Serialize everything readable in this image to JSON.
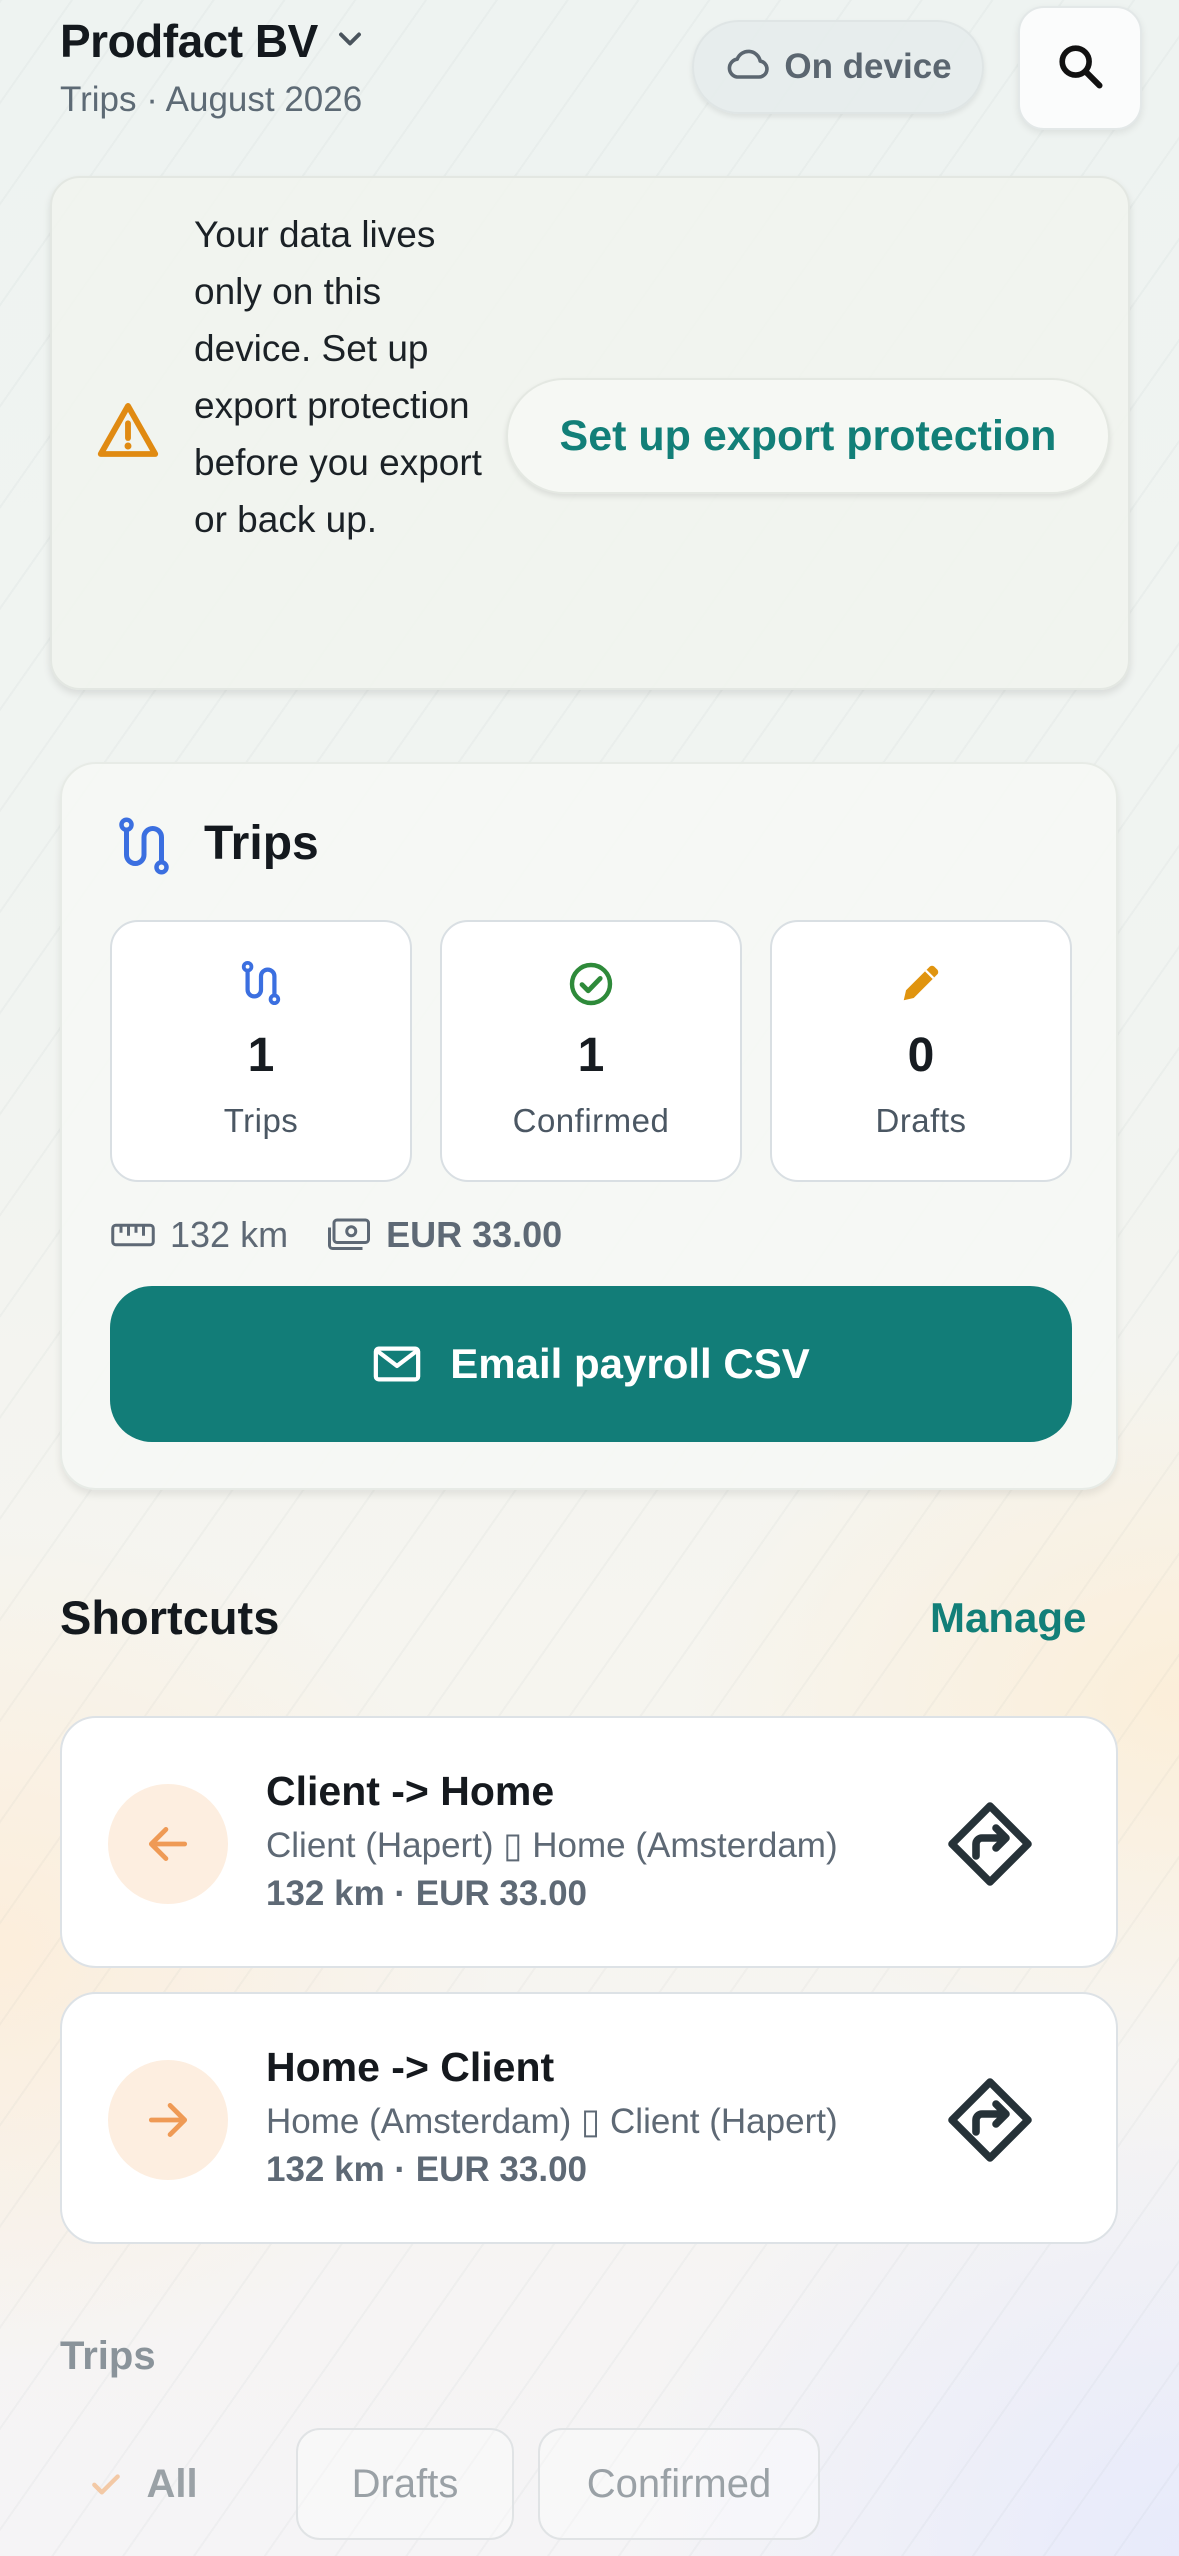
{
  "header": {
    "company": "Prodfact BV",
    "subtitle": "Trips · August 2026",
    "storage_badge": "On device",
    "icons": {
      "dropdown": "chevron-down-icon",
      "storage": "cloud-icon",
      "search": "search-icon"
    }
  },
  "banner": {
    "text": "Your data lives only on this device. Set up export protection before you export or back up.",
    "button": "Set up export protection",
    "icon": "warning-icon",
    "colors": {
      "warning": "#e08a12",
      "accent": "#127f78"
    }
  },
  "trips_summary": {
    "title": "Trips",
    "stats": [
      {
        "value": "1",
        "label": "Trips",
        "icon": "route-icon",
        "color": "#3b6fe0"
      },
      {
        "value": "1",
        "label": "Confirmed",
        "icon": "check-circle-icon",
        "color": "#2e8a3a"
      },
      {
        "value": "0",
        "label": "Drafts",
        "icon": "pencil-icon",
        "color": "#e0940f"
      }
    ],
    "distance": "132 km",
    "amount": "EUR 33.00",
    "email_button": "Email payroll CSV",
    "button_color": "#127d78"
  },
  "shortcuts": {
    "title": "Shortcuts",
    "manage": "Manage",
    "items": [
      {
        "name": "Client -> Home",
        "route": "Client (Hapert) ▯ Home (Amsterdam)",
        "info": "132 km · EUR 33.00",
        "direction_icon": "arrow-left-icon",
        "action_icon": "directions-icon"
      },
      {
        "name": "Home -> Client",
        "route": "Home (Amsterdam) ▯ Client (Hapert)",
        "info": "132 km · EUR 33.00",
        "direction_icon": "arrow-right-icon",
        "action_icon": "directions-icon"
      }
    ]
  },
  "trips_list": {
    "title": "Trips",
    "filters": [
      {
        "label": "All",
        "selected": true
      },
      {
        "label": "Drafts",
        "selected": false
      },
      {
        "label": "Confirmed",
        "selected": false
      }
    ]
  }
}
